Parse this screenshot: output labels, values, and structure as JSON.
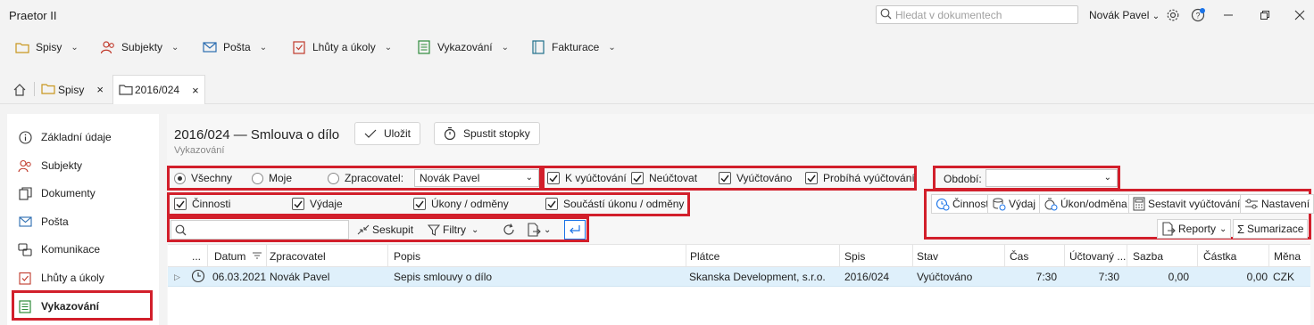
{
  "app": {
    "title": "Praetor II"
  },
  "search": {
    "placeholder": "Hledat v dokumentech"
  },
  "user": {
    "name": "Novák Pavel"
  },
  "window_controls": [
    "minimize-icon",
    "restore-icon",
    "close-icon"
  ],
  "menu": [
    {
      "label": "Spisy",
      "icon": "folder-icon"
    },
    {
      "label": "Subjekty",
      "icon": "people-icon"
    },
    {
      "label": "Pošta",
      "icon": "mail-icon"
    },
    {
      "label": "Lhůty a úkoly",
      "icon": "checklist-icon"
    },
    {
      "label": "Vykazování",
      "icon": "timesheet-icon"
    },
    {
      "label": "Fakturace",
      "icon": "invoice-icon"
    }
  ],
  "tabs": [
    {
      "label": "Spisy",
      "icon": "folder-icon"
    },
    {
      "label": "2016/024",
      "icon": "folder-icon"
    }
  ],
  "sidebar": {
    "items": [
      {
        "label": "Základní údaje",
        "icon": "info-icon"
      },
      {
        "label": "Subjekty",
        "icon": "people-icon"
      },
      {
        "label": "Dokumenty",
        "icon": "documents-icon"
      },
      {
        "label": "Pošta",
        "icon": "mail-icon"
      },
      {
        "label": "Komunikace",
        "icon": "chat-icon"
      },
      {
        "label": "Lhůty a úkoly",
        "icon": "checklist-icon"
      },
      {
        "label": "Vykazování",
        "icon": "timesheet-icon"
      }
    ],
    "active_index": 6
  },
  "page": {
    "title": "2016/024 — Smlouva o dílo",
    "subtitle": "Vykazování",
    "save_label": "Uložit",
    "timer_label": "Spustit stopky"
  },
  "filters": {
    "scope": {
      "all": "Všechny",
      "mine": "Moje",
      "worker": "Zpracovatel:",
      "selected": "all"
    },
    "worker_value": "Novák Pavel",
    "states": [
      "K vyúčtování",
      "Neúčtovat",
      "Vyúčtováno",
      "Probíhá vyúčtování"
    ],
    "types": [
      "Činnosti",
      "Výdaje",
      "Úkony / odměny",
      "Součástí úkonu / odměny"
    ],
    "period_label": "Období:",
    "period_value": ""
  },
  "toolbar": {
    "group_label": "Seskupit",
    "filters_label": "Filtry"
  },
  "actions": {
    "activity": "Činnost",
    "expense": "Výdaj",
    "task_fee": "Úkon/odměna",
    "build_billing": "Sestavit vyúčtování",
    "settings": "Nastavení",
    "reports": "Reporty",
    "summary": "Sumarizace"
  },
  "grid": {
    "columns": [
      "...",
      "Datum",
      "Zpracovatel",
      "Popis",
      "Plátce",
      "Spis",
      "Stav",
      "Čas",
      "Účtovaný ...",
      "Sazba",
      "Částka",
      "Měna"
    ],
    "rows": [
      {
        "date": "06.03.2021",
        "worker": "Novák Pavel",
        "description": "Sepis smlouvy o dílo",
        "payer": "Skanska Development, s.r.o.",
        "file": "2016/024",
        "state": "Vyúčtováno",
        "time": "7:30",
        "billed": "7:30",
        "rate": "0,00",
        "amount": "0,00",
        "currency": "CZK"
      }
    ]
  },
  "colors": {
    "highlight": "#d21f2b",
    "selected_row": "#dff0fb"
  }
}
